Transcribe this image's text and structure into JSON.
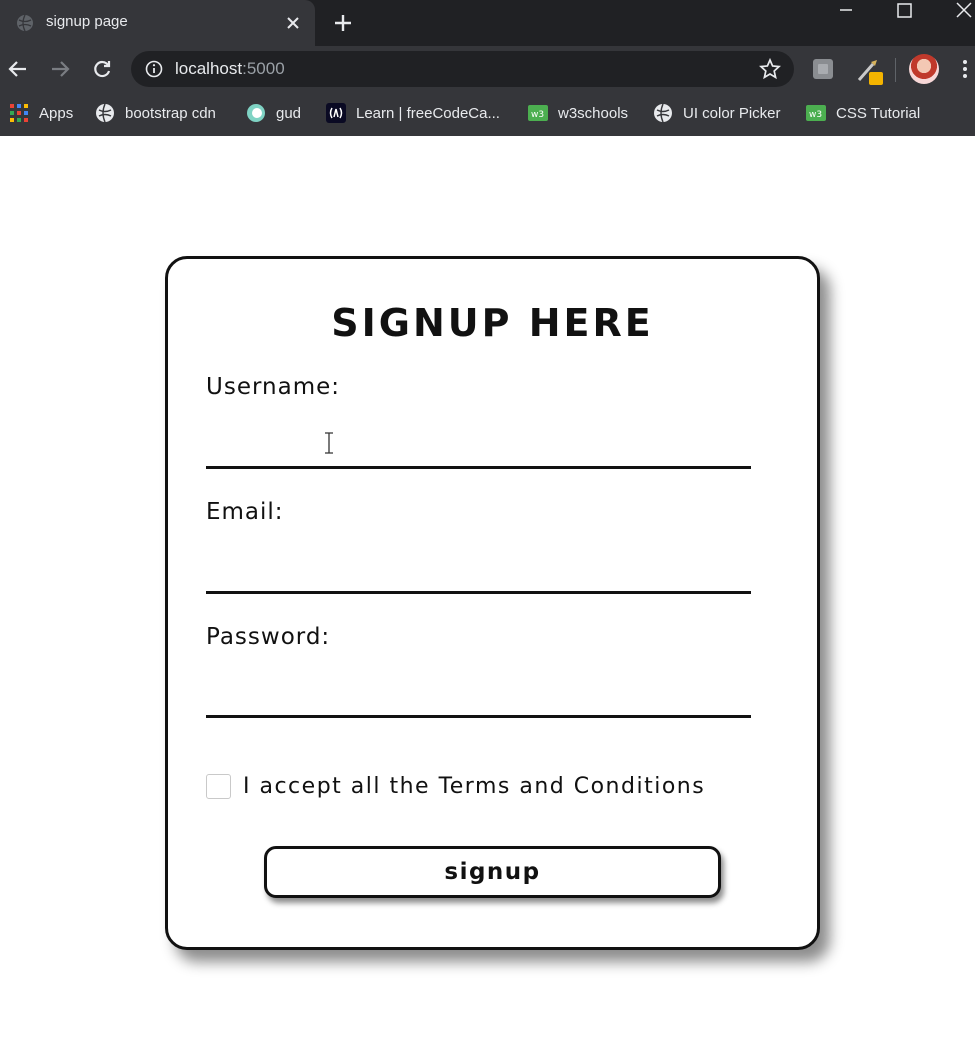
{
  "browser": {
    "tab": {
      "title": "signup page",
      "favicon": "globe-icon"
    },
    "new_tab_icon": "plus-icon",
    "address": {
      "host": "localhost",
      "port": ":5000",
      "security_icon": "info-icon"
    },
    "bookmarks": [
      {
        "label": "Apps",
        "icon": "apps-grid-icon"
      },
      {
        "label": "bootstrap cdn",
        "icon": "globe-icon"
      },
      {
        "label": "gud",
        "icon": "circle-logo-icon"
      },
      {
        "label": "Learn | freeCodeCa...",
        "icon": "freecodecamp-icon"
      },
      {
        "label": "w3schools",
        "icon": "w3schools-icon"
      },
      {
        "label": "UI color Picker",
        "icon": "globe-icon"
      },
      {
        "label": "CSS Tutorial",
        "icon": "w3schools-icon"
      }
    ]
  },
  "form": {
    "title": "SIGNUP HERE",
    "fields": [
      {
        "label": "Username:",
        "value": ""
      },
      {
        "label": "Email:",
        "value": ""
      },
      {
        "label": "Password:",
        "value": ""
      }
    ],
    "terms_label": "I accept all the Terms and Conditions",
    "terms_checked": false,
    "submit_label": "signup"
  },
  "colors": {
    "chrome_dark": "#202124",
    "chrome_tab": "#35363a",
    "text_light": "#e8eaed",
    "card_border": "#111111",
    "page_bg": "#ffffff"
  }
}
